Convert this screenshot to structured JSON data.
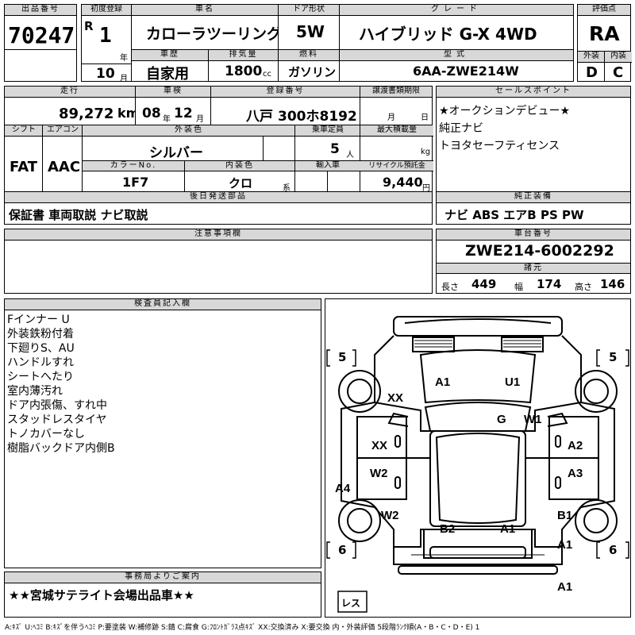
{
  "headers": {
    "lot": "出品番号",
    "first_reg": "初度登録",
    "car_name": "車名",
    "door": "ドア形状",
    "grade": "グレード",
    "score": "評価点",
    "history": "車歴",
    "displacement": "排気量",
    "fuel": "燃料",
    "model_code": "型式",
    "exterior": "外装",
    "interior": "内装",
    "mileage": "走行",
    "inspection": "車検",
    "reg_no": "登録番号",
    "transfer": "譲渡書類期限",
    "sales_points": "セールスポイント",
    "shift": "シフト",
    "aircon": "エアコン",
    "ext_color": "外装色",
    "capacity": "乗車定員",
    "max_load": "最大積載量",
    "color_no": "カラーNo.",
    "int_color": "内装色",
    "import": "輸入車",
    "recycle": "リサイクル預託金",
    "later_parts": "後日発送部品",
    "genuine": "純正装備",
    "caution": "注意事項欄",
    "chassis": "車台番号",
    "dims": "諸元",
    "inspector": "検査員記入欄",
    "office": "事務局よりご案内"
  },
  "vehicle": {
    "lot_number": "70247",
    "era": "R",
    "reg_year": "1",
    "year_unit": "年",
    "reg_month": "10",
    "month_unit": "月",
    "car_name": "カローラツーリング",
    "door": "5W",
    "grade": "ハイブリッド G-X 4WD",
    "score": "RA",
    "history": "自家用",
    "displacement": "1800",
    "cc_unit": "cc",
    "fuel": "ガソリン",
    "model_code": "6AA-ZWE214W",
    "exterior_grade": "D",
    "interior_grade": "C",
    "mileage": "89,272",
    "km_unit": "km",
    "inspection_year": "08",
    "inspection_month": "12",
    "insp_year_unit": "年",
    "insp_month_unit": "月",
    "plate_region": "八戸",
    "plate_number": "300ホ8192",
    "transfer_month": "月",
    "transfer_day": "日",
    "shift": "FAT",
    "aircon": "AAC",
    "ext_color": "シルバー",
    "capacity": "5",
    "capacity_unit": "人",
    "load_unit": "kg",
    "color_no": "1F7",
    "int_color": "クロ",
    "int_color_unit": "系",
    "recycle_fee": "9,440",
    "yen_unit": "円",
    "later_parts": "保証書 車両取説 ナビ取説",
    "genuine_equipment": "ナビ ABS エアB PS PW",
    "chassis_number": "ZWE214-6002292",
    "length_label": "長さ",
    "length": "449",
    "width_label": "幅",
    "width": "174",
    "height_label": "高さ",
    "height": "146"
  },
  "sales_points": [
    "★オークションデビュー★",
    "純正ナビ",
    "トヨタセーフティセンス"
  ],
  "inspector_notes": [
    "Fインナー U",
    "外装鉄粉付着",
    "下廻りS、AU",
    "ハンドルすれ",
    "シートへたり",
    "室内薄汚れ",
    "ドア内張傷、すれ中",
    "スタッドレスタイヤ",
    "トノカバーなし",
    "樹脂バックドア内側B"
  ],
  "office_note": "★★宮城サテライト会場出品車★★",
  "tire_tread": {
    "front_left": "5",
    "front_right": "5",
    "rear_left": "6",
    "rear_right": "6",
    "spare": "レス"
  },
  "damage_codes": {
    "hood_left": "A1",
    "hood_right": "U1",
    "windshield": "G",
    "fender_right": "W1",
    "fender_left": "XX",
    "front_door_left": "XX",
    "front_door_right": "A2",
    "rear_door_left": "W2",
    "rear_door_right": "A3",
    "rocker_left": "A4",
    "quarter_left": "W2",
    "quarter_right": "B1",
    "trunk_left": "B2",
    "trunk_right": "A1",
    "rear_right_corner": "A1",
    "rear_bumper": "A1"
  },
  "legend": "A:ｷｽﾞ U:ﾍｺﾐ B:ｷｽﾞを伴うﾍｺﾐ P:要塗装 W:補修跡 S:錆 C:腐食 G:ﾌﾛﾝﾄｶﾞﾗｽ点ｷｽﾞ XX:交換済み X:要交換 内・外装評価 5段階ﾗﾝｸ順(A・B・C・D・E) 1"
}
